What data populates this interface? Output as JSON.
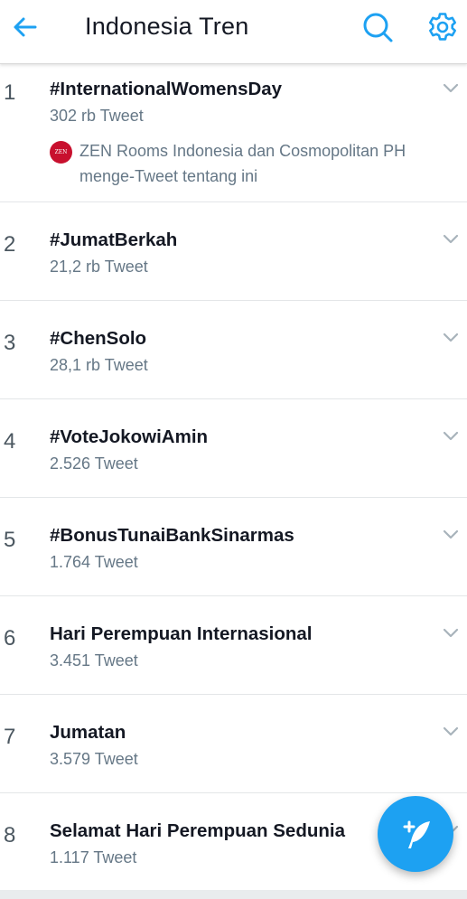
{
  "header": {
    "title": "Indonesia Tren",
    "back_icon": "arrow-left-icon",
    "search_icon": "search-icon",
    "settings_icon": "gear-icon"
  },
  "colors": {
    "accent": "#1DA1F2",
    "text_primary": "#141823",
    "text_secondary": "#657786",
    "divider": "#E3E6E8",
    "context_avatar": "#C8102E"
  },
  "trends": [
    {
      "rank": "1",
      "name": "#InternationalWomensDay",
      "count": "302 rb Tweet",
      "context": {
        "avatar_text": "ZEN",
        "text": "ZEN Rooms Indonesia dan Cosmopolitan PH menge-Tweet tentang ini"
      }
    },
    {
      "rank": "2",
      "name": "#JumatBerkah",
      "count": "21,2 rb Tweet"
    },
    {
      "rank": "3",
      "name": "#ChenSolo",
      "count": "28,1 rb Tweet"
    },
    {
      "rank": "4",
      "name": "#VoteJokowiAmin",
      "count": "2.526 Tweet"
    },
    {
      "rank": "5",
      "name": "#BonusTunaiBankSinarmas",
      "count": "1.764 Tweet"
    },
    {
      "rank": "6",
      "name": "Hari Perempuan Internasional",
      "count": "3.451 Tweet"
    },
    {
      "rank": "7",
      "name": "Jumatan",
      "count": "3.579 Tweet"
    },
    {
      "rank": "8",
      "name": "Selamat Hari Perempuan Sedunia",
      "count": "1.117 Tweet"
    }
  ],
  "fab": {
    "icon": "compose-tweet-icon"
  }
}
